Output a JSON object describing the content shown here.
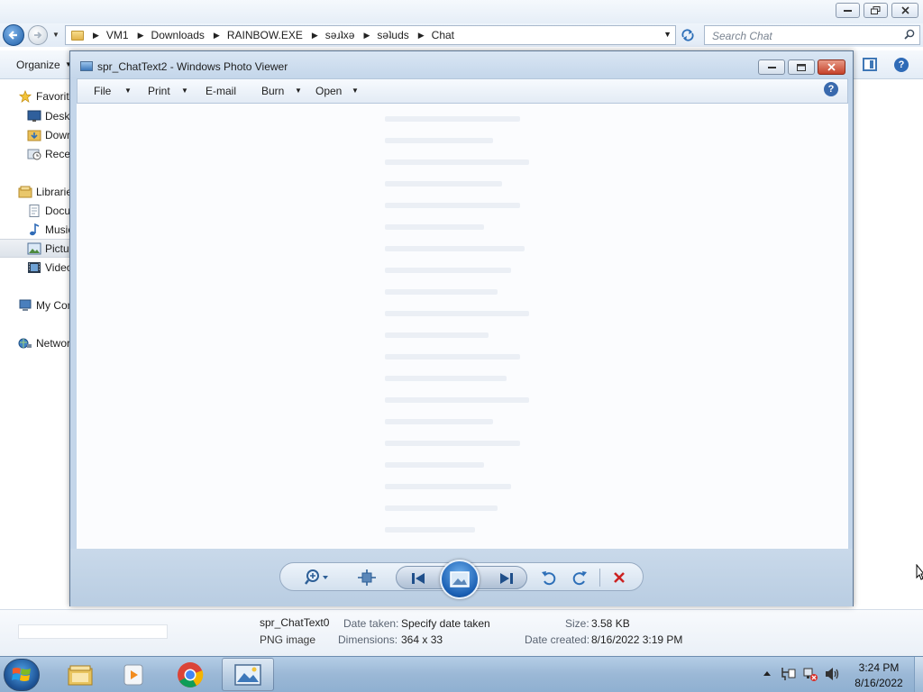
{
  "explorer": {
    "breadcrumb": [
      "VM1",
      "Downloads",
      "RAINBOW.EXE",
      "sǝɹʇxǝ",
      "sǝʇuds",
      "Chat"
    ],
    "search_placeholder": "Search Chat",
    "toolbar": {
      "organize_label": "Organize"
    },
    "nav": {
      "favorites": "Favorites",
      "desktop": "Desktop",
      "downloads": "Downloads",
      "recent": "Recent Places",
      "libraries": "Libraries",
      "documents": "Documents",
      "music": "Music",
      "pictures": "Pictures",
      "videos": "Videos",
      "computer": "My Computer",
      "network": "Network"
    },
    "details": {
      "file_name": "spr_ChatText0",
      "file_type": "PNG image",
      "date_taken_label": "Date taken:",
      "date_taken_value": "Specify date taken",
      "dimensions_label": "Dimensions:",
      "dimensions_value": "364 x 33",
      "size_label": "Size:",
      "size_value": "3.58 KB",
      "date_created_label": "Date created:",
      "date_created_value": "8/16/2022 3:19 PM"
    }
  },
  "viewer": {
    "title": "spr_ChatText2 - Windows Photo Viewer",
    "menus": {
      "file": "File",
      "print": "Print",
      "email": "E-mail",
      "burn": "Burn",
      "open": "Open"
    },
    "controls": [
      "zoom-icon",
      "actual-size-icon",
      "previous-icon",
      "slideshow-icon",
      "next-icon",
      "rotate-counterclockwise-icon",
      "rotate-clockwise-icon",
      "delete-icon"
    ]
  },
  "taskbar": {
    "apps": [
      "windows-explorer-icon",
      "media-player-icon",
      "chrome-icon",
      "photo-viewer-icon"
    ],
    "clock_time": "3:24 PM",
    "clock_date": "8/16/2022"
  },
  "colors": {
    "accent": "#1a5fb3",
    "delete_red": "#cc2222",
    "viewer_frame": "#c4d6ea"
  }
}
